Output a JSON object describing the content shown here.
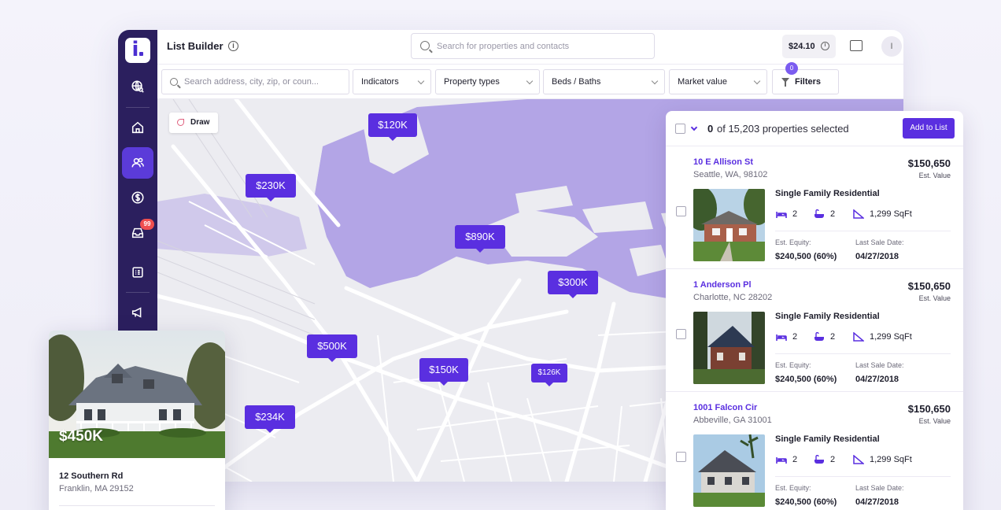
{
  "app": {
    "title": "List Builder",
    "search_placeholder": "Search for properties and contacts",
    "credits": "$24.10",
    "avatar_initial": "I",
    "inbox_badge": "99"
  },
  "sidebar": {
    "items": [
      {
        "name": "globe-search-icon"
      },
      {
        "name": "home-icon"
      },
      {
        "name": "users-icon",
        "active": true
      },
      {
        "name": "dollar-icon"
      },
      {
        "name": "inbox-icon"
      },
      {
        "name": "list-icon"
      },
      {
        "name": "megaphone-icon"
      }
    ]
  },
  "filters": {
    "search_placeholder": "Search address, city, zip, or coun...",
    "indicators": "Indicators",
    "property_types": "Property types",
    "beds_baths": "Beds / Baths",
    "market_value": "Market value",
    "filters_label": "Filters",
    "filters_count": "0"
  },
  "map": {
    "draw_label": "Draw",
    "pins": [
      "$120K",
      "$230K",
      "$890K",
      "$300K",
      "$500K",
      "$150K",
      "$126K",
      "$234K"
    ]
  },
  "floating_card": {
    "price": "$450K",
    "address": "12 Southern Rd",
    "city": "Franklin, MA 29152"
  },
  "results": {
    "selected": "0",
    "of_text": "of 15,203 properties selected",
    "add_button": "Add to List",
    "labels": {
      "est_value": "Est. Value",
      "equity": "Est. Equity:",
      "last_sale": "Last Sale Date:"
    },
    "rows": [
      {
        "street": "10 E Allison St",
        "city": "Seattle, WA, 98102",
        "value": "$150,650",
        "type": "Single Family Residential",
        "beds": "2",
        "baths": "2",
        "sqft": "1,299 SqFt",
        "equity": "$240,500 (60%)",
        "sale_date": "04/27/2018"
      },
      {
        "street": "1 Anderson Pl",
        "city": "Charlotte, NC 28202",
        "value": "$150,650",
        "type": "Single Family Residential",
        "beds": "2",
        "baths": "2",
        "sqft": "1,299 SqFt",
        "equity": "$240,500 (60%)",
        "sale_date": "04/27/2018"
      },
      {
        "street": "1001 Falcon Cir",
        "city": "Abbeville, GA 31001",
        "value": "$150,650",
        "type": "Single Family Residential",
        "beds": "2",
        "baths": "2",
        "sqft": "1,299 SqFt",
        "equity": "$240,500 (60%)",
        "sale_date": "04/27/2018"
      }
    ]
  },
  "colors": {
    "brand": "#5a2fe0",
    "sidebar": "#2b1f5e",
    "water": "#b3a5e6"
  }
}
